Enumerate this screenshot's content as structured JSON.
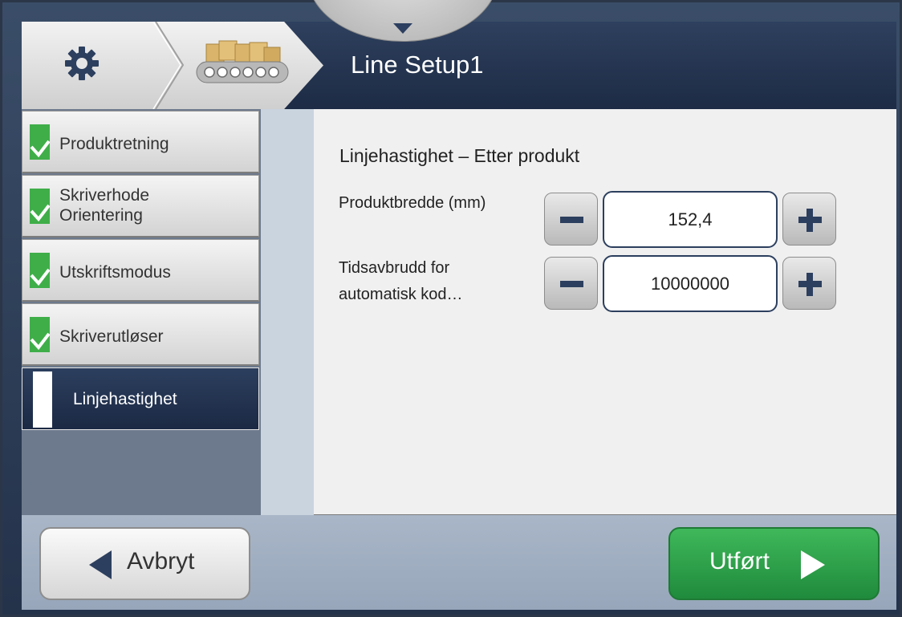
{
  "header": {
    "title": "Line Setup1",
    "breadcrumb_icons": [
      "gear-icon",
      "conveyor-icon"
    ]
  },
  "sidebar": {
    "items": [
      {
        "label": "Produktretning",
        "status": "complete"
      },
      {
        "label": "Skriverhode Orientering",
        "status": "complete"
      },
      {
        "label": "Utskriftsmodus",
        "status": "complete"
      },
      {
        "label": "Skriverutløser",
        "status": "complete"
      },
      {
        "label": "Linjehastighet",
        "status": "active"
      }
    ]
  },
  "main": {
    "section_title": "Linjehastighet – Etter produkt",
    "fields": [
      {
        "label": "Produktbredde (mm)",
        "value": "152,4"
      },
      {
        "label": "Tidsavbrudd for automatisk kod…",
        "value": "10000000"
      }
    ]
  },
  "footer": {
    "cancel_label": "Avbryt",
    "done_label": "Utført"
  },
  "colors": {
    "header": "#24324a",
    "complete_check": "#3fae49",
    "done_button": "#2a9a45"
  }
}
